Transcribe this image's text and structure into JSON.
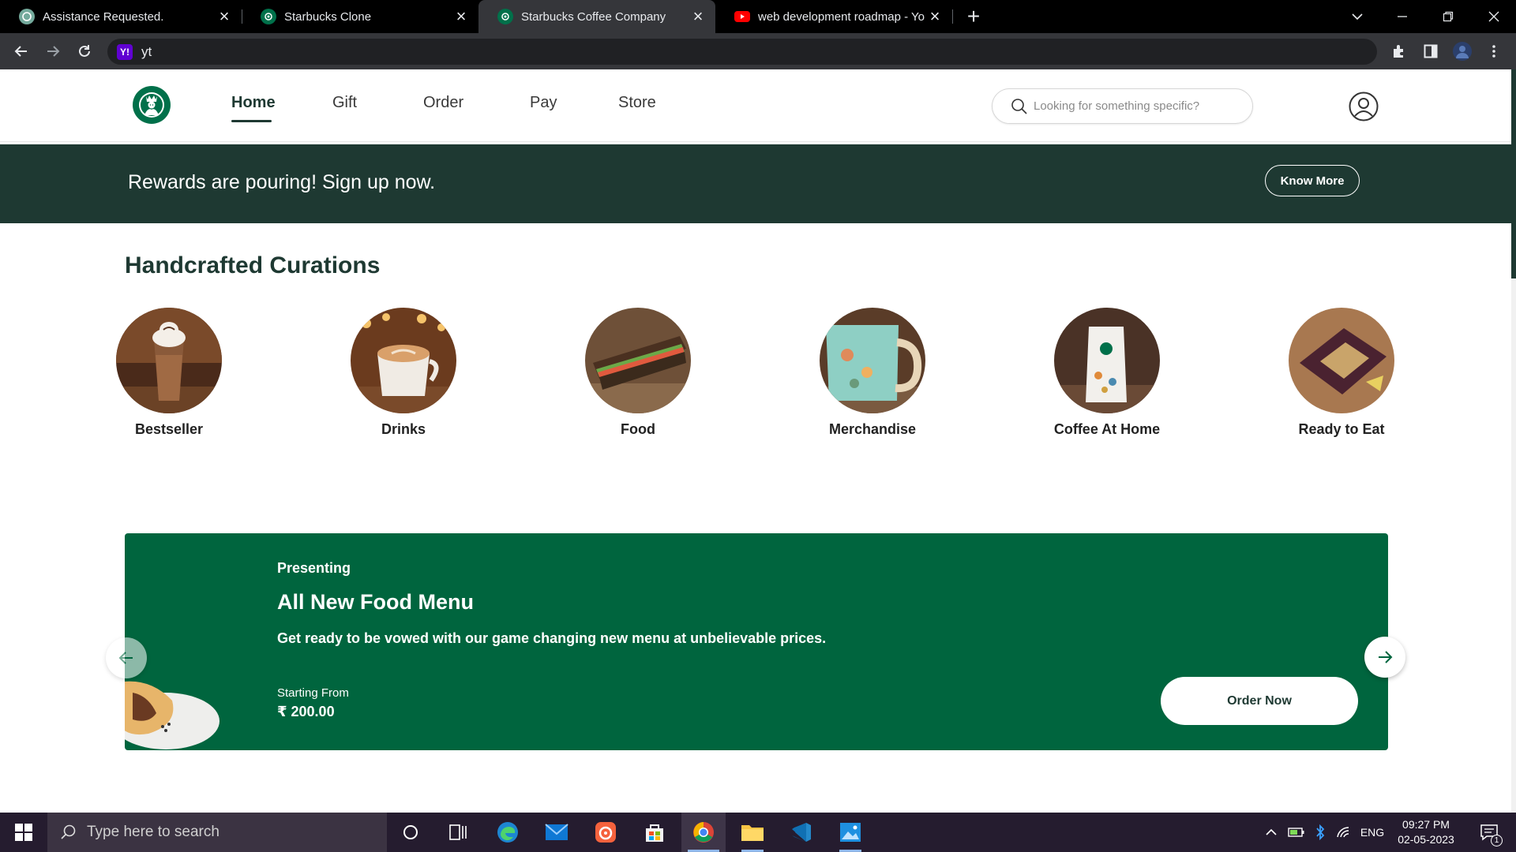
{
  "browser": {
    "tabs": [
      {
        "label": "Assistance Requested.",
        "icon": "chatgpt-icon"
      },
      {
        "label": "Starbucks Clone",
        "icon": "starbucks-favicon"
      },
      {
        "label": "Starbucks Coffee Company",
        "icon": "starbucks-favicon",
        "active": true
      },
      {
        "label": "web development roadmap - YouTube",
        "icon": "youtube-icon"
      }
    ],
    "address": "yt",
    "address_icon": "Y!"
  },
  "site": {
    "nav": [
      "Home",
      "Gift",
      "Order",
      "Pay",
      "Store"
    ],
    "active_nav": "Home",
    "search_placeholder": "Looking for something specific?",
    "promo": {
      "text": "Rewards are pouring! Sign up now.",
      "button": "Know More"
    },
    "section_title": "Handcrafted Curations",
    "categories": [
      "Bestseller",
      "Drinks",
      "Food",
      "Merchandise",
      "Coffee At Home",
      "Ready to Eat"
    ],
    "banner": {
      "kicker": "Presenting",
      "title": "All New Food Menu",
      "description": "Get ready to be vowed with our game changing new menu at unbelievable prices.",
      "price_label": "Starting From",
      "price": "₹ 200.00",
      "button": "Order Now"
    }
  },
  "colors": {
    "brand_dark": "#1e3932",
    "brand_green": "#00653e",
    "starbucks_logo": "#00704a"
  },
  "taskbar": {
    "search_placeholder": "Type here to search",
    "language": "ENG",
    "time": "09:27 PM",
    "date": "02-05-2023",
    "notification_count": "1"
  }
}
